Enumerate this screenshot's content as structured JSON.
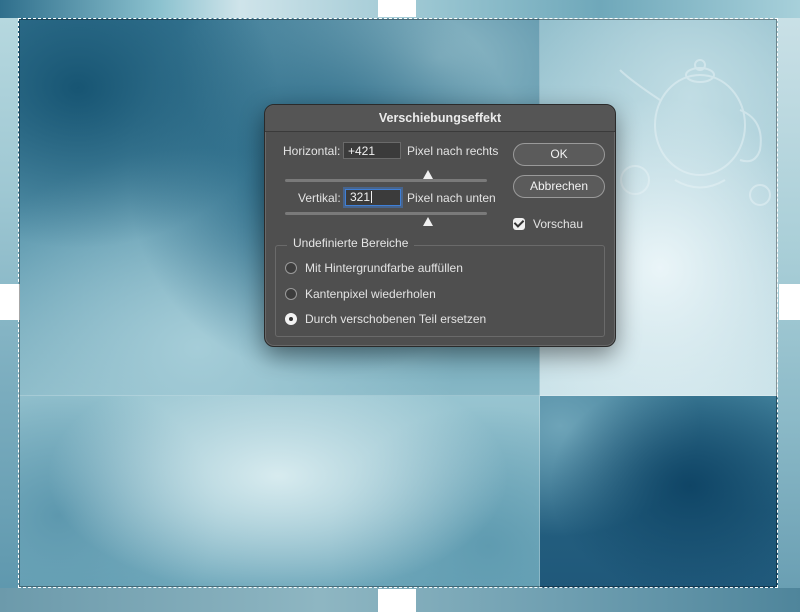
{
  "dialog": {
    "title": "Verschiebungseffekt",
    "horizontal": {
      "label": "Horizontal:",
      "value": "+421",
      "unit": "Pixel nach rechts",
      "slider_fraction": 0.71
    },
    "vertical": {
      "label": "Vertikal:",
      "value": "321",
      "unit": "Pixel nach unten",
      "slider_fraction": 0.71
    },
    "ok_label": "OK",
    "cancel_label": "Abbrechen",
    "preview": {
      "label": "Vorschau",
      "checked": true
    },
    "undefined_areas": {
      "legend": "Undefinierte Bereiche",
      "options": [
        {
          "label": "Mit Hintergrundfarbe auffüllen",
          "selected": false
        },
        {
          "label": "Kantenpixel wiederholen",
          "selected": false
        },
        {
          "label": "Durch verschobenen Teil ersetzen",
          "selected": true
        }
      ]
    }
  },
  "colors": {
    "dialog_bg": "#4f4f4f",
    "focus_ring": "#3f7fd6",
    "canvas_dark": "#175573",
    "canvas_light": "#d7ebef"
  }
}
